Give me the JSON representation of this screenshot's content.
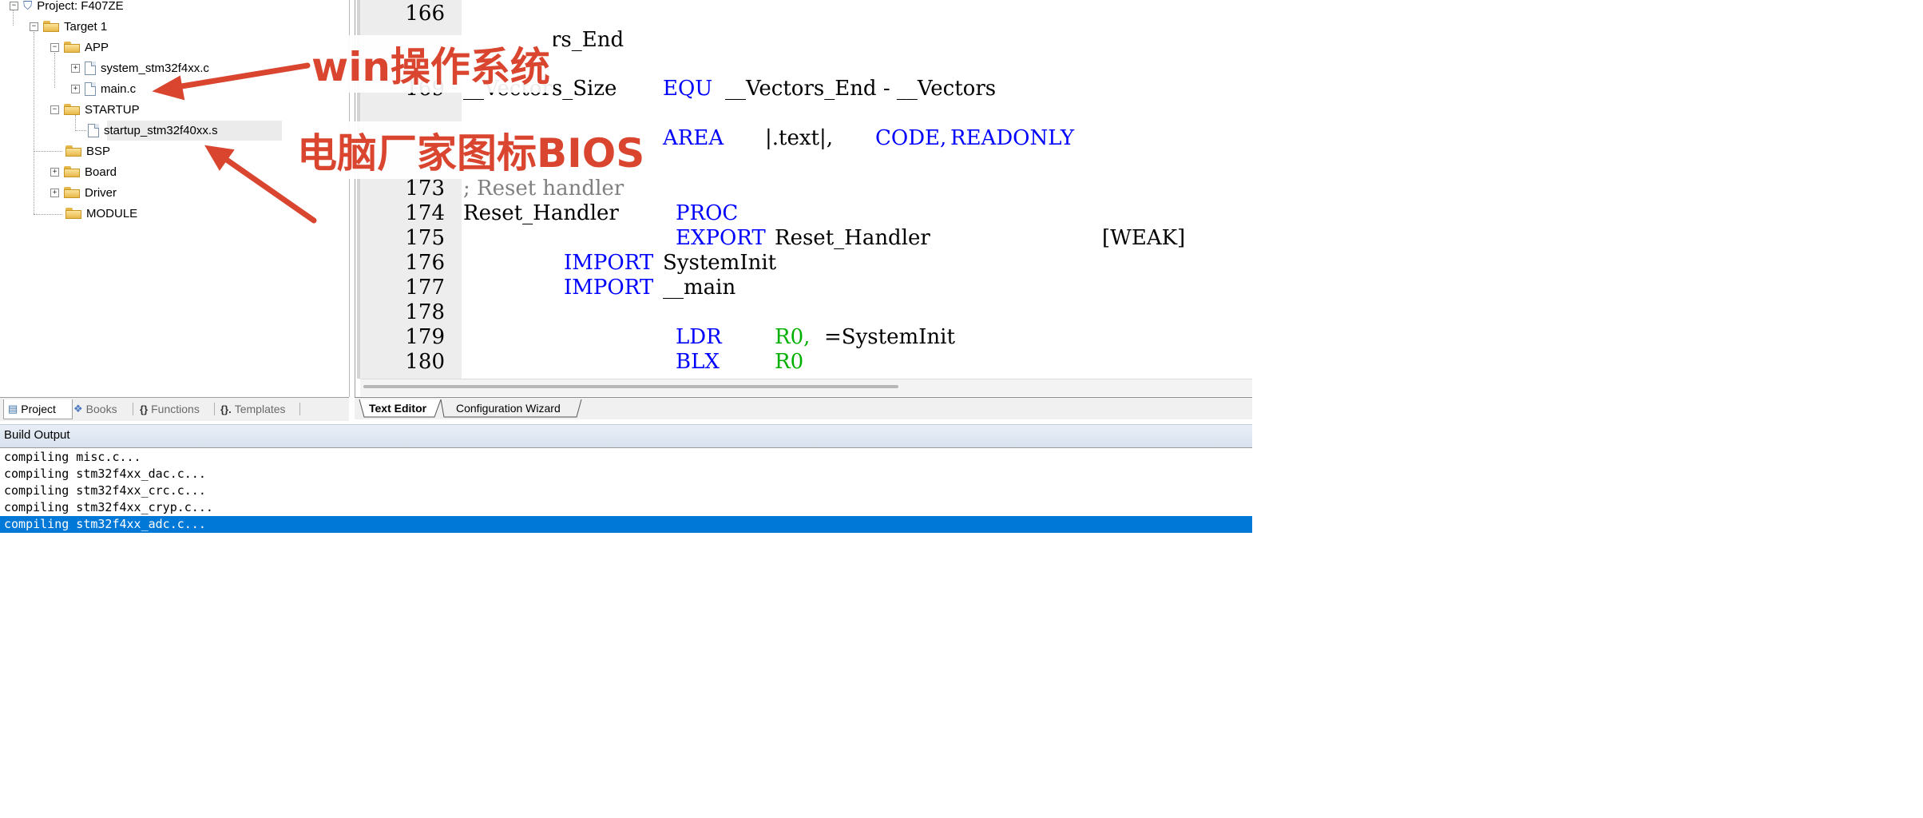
{
  "tree": {
    "project_label": "Project: F407ZE",
    "target_label": "Target 1",
    "groups": [
      {
        "label": "APP",
        "expander": "⊟"
      },
      {
        "label": "STARTUP",
        "expander": "⊟"
      },
      {
        "label": "BSP",
        "expander": ""
      },
      {
        "label": "Board",
        "expander": "⊞"
      },
      {
        "label": "Driver",
        "expander": "⊞"
      },
      {
        "label": "MODULE",
        "expander": ""
      }
    ],
    "files": [
      {
        "label": "system_stm32f4xx.c"
      },
      {
        "label": "main.c"
      },
      {
        "label": "startup_stm32f40xx.s"
      }
    ]
  },
  "panel_tabs": [
    {
      "label": "Project",
      "icon": "project-icon"
    },
    {
      "label": "Books",
      "icon": "books-icon"
    },
    {
      "label": "Functions",
      "icon": "braces-icon"
    },
    {
      "label": "Templates",
      "icon": "templates-icon"
    }
  ],
  "editor": {
    "lines": [
      {
        "num": "166",
        "t1": "",
        "t2": "",
        "t3": "",
        "t4": ""
      },
      {
        "num": "",
        "t1": "rs_End",
        "t2": "",
        "t3": "",
        "t4": ""
      },
      {
        "num": "169",
        "t1": "__Vectors_Size",
        "t2": "EQU",
        "t3": "__Vectors_End - __Vectors",
        "t4": ""
      },
      {
        "num": "",
        "t1": "AREA",
        "t2": "|.text|,",
        "t3": "CODE,",
        "t4": "READONLY"
      },
      {
        "num": "173",
        "t1": "; Reset handler"
      },
      {
        "num": "174",
        "t1": "Reset_Handler",
        "t2": "PROC"
      },
      {
        "num": "175",
        "t1": "EXPORT",
        "t2": "Reset_Handler",
        "t3": "[WEAK]"
      },
      {
        "num": "176",
        "t1": "IMPORT",
        "t2": "SystemInit"
      },
      {
        "num": "177",
        "t1": "IMPORT",
        "t2": "__main"
      },
      {
        "num": "178"
      },
      {
        "num": "179",
        "t1": "LDR",
        "t2": "R0,",
        "t3": "=SystemInit"
      },
      {
        "num": "180",
        "t1": "BLX",
        "t2": "R0"
      }
    ],
    "tabs": [
      {
        "label": "Text Editor"
      },
      {
        "label": "Configuration Wizard"
      }
    ]
  },
  "build": {
    "title": "Build Output",
    "lines": [
      "compiling misc.c...",
      "compiling stm32f4xx_dac.c...",
      "compiling stm32f4xx_crc.c...",
      "compiling stm32f4xx_cryp.c...",
      "compiling stm32f4xx_adc.c..."
    ]
  },
  "annotations": {
    "top": "win操作系统",
    "bottom": "电脑厂家图标BIOS"
  },
  "colors": {
    "keyword": "#0000ff",
    "comment": "#808080",
    "register": "#00b000",
    "annotation": "#d9452f",
    "selection": "#0078d7"
  }
}
